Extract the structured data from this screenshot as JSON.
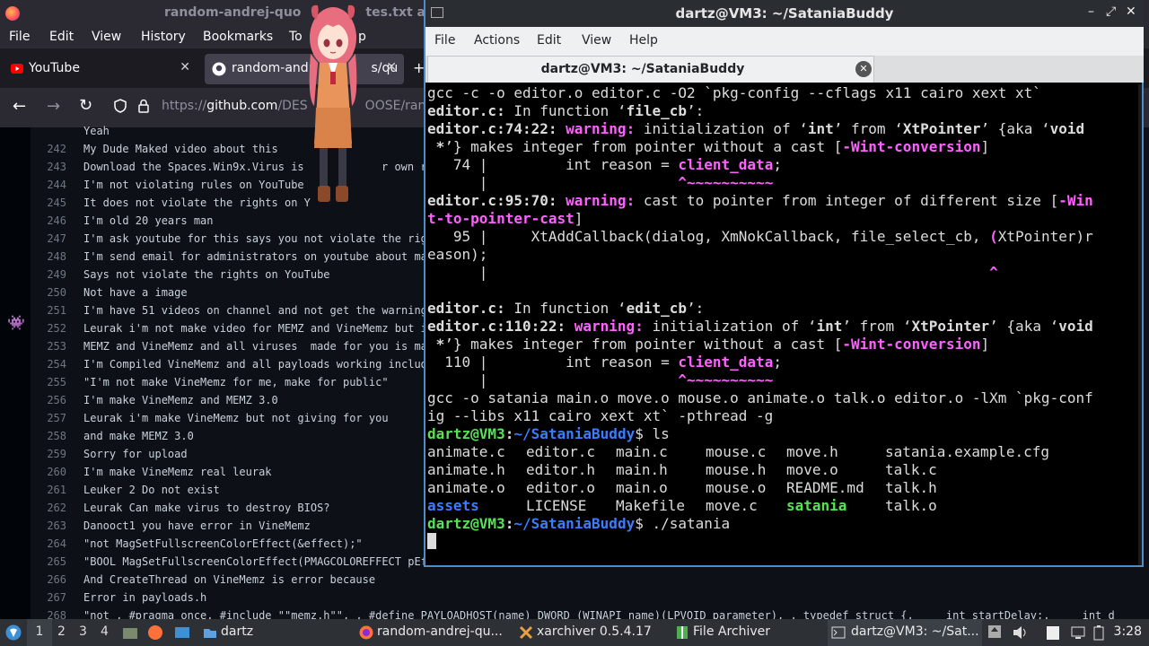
{
  "firefox": {
    "window_title": "random-andrej-quotes.txt at master · DESTROY_OOSE/random-andrej-quotes",
    "title_visible": "random-andrej-quo",
    "title_visible_end": "tes.txt a",
    "menu": [
      "File",
      "Edit",
      "View",
      "History",
      "Bookmarks",
      "Tools",
      "Help"
    ],
    "menu_tools_visible": "To",
    "menu_help_visible": "p",
    "tabs": [
      {
        "label": "YouTube",
        "icon": "youtube-icon"
      },
      {
        "label": "random-andr",
        "label_end": "s/qu",
        "icon": "github-icon"
      }
    ],
    "url_prefix": "https://",
    "url_host": "github.com",
    "url_path": "/DES",
    "url_path_end": "OOSE/rand",
    "code_lines": [
      {
        "n": "",
        "t": "Yeah"
      },
      {
        "n": "242",
        "t": "My Dude Maked video about this"
      },
      {
        "n": "243",
        "t": "Download the Spaces.Win9x.Virus is",
        "t2": "r own risk"
      },
      {
        "n": "244",
        "t": "I'm not violating rules on YouTube"
      },
      {
        "n": "245",
        "t": "It does not violate the rights on Y"
      },
      {
        "n": "246",
        "t": "I'm old 20 years man"
      },
      {
        "n": "247",
        "t": "I'm ask youtube for this says you not violate the rig"
      },
      {
        "n": "248",
        "t": "I'm send email for administrators on youtube about ma"
      },
      {
        "n": "249",
        "t": "Says not violate the rights on YouTube"
      },
      {
        "n": "250",
        "t": "Not have a image"
      },
      {
        "n": "251",
        "t": "I'm have 51 videos on channel and not get the warning"
      },
      {
        "n": "252",
        "t": "Leurak i'm not make video for MEMZ and VineMemz but i"
      },
      {
        "n": "253",
        "t": "MEMZ and VineMemz and all viruses  made for you is ma"
      },
      {
        "n": "254",
        "t": "I'm Compiled VineMemz and all payloads working includ"
      },
      {
        "n": "255",
        "t": "\"I'm not make VineMemz for me, make for public\""
      },
      {
        "n": "256",
        "t": "I'm make VineMemz and MEMZ 3.0"
      },
      {
        "n": "257",
        "t": "Leurak i'm make VineMemz but not giving for you"
      },
      {
        "n": "258",
        "t": "and make MEMZ 3.0"
      },
      {
        "n": "259",
        "t": "Sorry for upload"
      },
      {
        "n": "260",
        "t": "I'm make VineMemz real leurak"
      },
      {
        "n": "261",
        "t": "Leuker 2 Do not exist"
      },
      {
        "n": "262",
        "t": "Leurak Can make virus to destroy BIOS?"
      },
      {
        "n": "263",
        "t": "Danooct1 you have error in VineMemz"
      },
      {
        "n": "264",
        "t": "\"not MagSetFullscreenColorEffect(&effect);\""
      },
      {
        "n": "265",
        "t": "\"BOOL MagSetFullscreenColorEffect(PMAGCOLOREFFECT pEf"
      },
      {
        "n": "266",
        "t": "And CreateThread on VineMemz is error because"
      },
      {
        "n": "267",
        "t": "Error in payloads.h"
      },
      {
        "n": "268",
        "t": "\"not , #pragma once, #include \"\"memz.h\"\", , #define PAYLOADHOST(name) DWORD (WINAPI name)(LPVOID parameter), , typedef struct {,     int startDelay;,     int d"
      }
    ]
  },
  "terminal": {
    "title": "dartz@VM3: ~/SataniaBuddy",
    "menu": [
      "File",
      "Actions",
      "Edit",
      "View",
      "Help"
    ],
    "tab_label": "dartz@VM3: ~/SataniaBuddy",
    "prompt_user": "dartz@VM3",
    "prompt_path": "~/SataniaBuddy",
    "lines": {
      "l0": "gcc -c -o editor.o editor.c -O2 `pkg-config --cflags x11 cairo xext xt`",
      "l1a": "editor.c:",
      "l1b": " In function ‘",
      "l1c": "file_cb",
      "l1d": "’:",
      "l2a": "editor.c:74:22:",
      "l2w": " warning: ",
      "l2b": "initialization of ‘",
      "l2c": "int",
      "l2d": "’ from ‘",
      "l2e": "XtPointer",
      "l2f": "’ {aka ‘",
      "l2g": "void",
      "l3a": " *",
      "l3b": "’} makes integer from pointer without a cast [",
      "l3c": "-Wint-conversion",
      "l3d": "]",
      "l4a": "   74 |         int reason = ",
      "l4b": "client_data",
      "l4c": ";",
      "l5a": "      |                      ",
      "l5b": "^~~~~~~~~~~",
      "l6a": "editor.c:95:70:",
      "l6w": " warning: ",
      "l6b": "cast to pointer from integer of different size [",
      "l6c": "-Win",
      "l7a": "t-to-pointer-cast",
      "l7b": "]",
      "l8a": "   95 |     XtAddCallback(dialog, XmNokCallback, file_select_cb, ",
      "l8b": "(",
      "l8c": "XtPointer)r",
      "l9": "eason);",
      "l10a": "      |                                                          ",
      "l10b": "^",
      "l12a": "editor.c:",
      "l12b": " In function ‘",
      "l12c": "edit_cb",
      "l12d": "’:",
      "l13a": "editor.c:110:22:",
      "l13w": " warning: ",
      "l13b": "initialization of ‘",
      "l13c": "int",
      "l13d": "’ from ‘",
      "l13e": "XtPointer",
      "l13f": "’ {aka ‘",
      "l13g": "void",
      "l14a": " *",
      "l14b": "’} makes integer from pointer without a cast [",
      "l14c": "-Wint-conversion",
      "l14d": "]",
      "l15a": "  110 |         int reason = ",
      "l15b": "client_data",
      "l15c": ";",
      "l16a": "      |                      ",
      "l16b": "^~~~~~~~~~~",
      "l17": "gcc -o satania main.o move.o mouse.o animate.o talk.o editor.o -lXm `pkg-conf",
      "l18": "ig --libs x11 cairo xext xt` -pthread -g",
      "cmd1": "$ ls",
      "cmd2": "$ ./satania"
    },
    "ls_rows": [
      [
        "animate.c",
        "editor.c",
        "main.c",
        "mouse.c",
        "move.h",
        "satania.example.cfg"
      ],
      [
        "animate.h",
        "editor.h",
        "main.h",
        "mouse.h",
        "move.o",
        "talk.c"
      ],
      [
        "animate.o",
        "editor.o",
        "main.o",
        "mouse.o",
        "README.md",
        "talk.h"
      ],
      [
        "assets",
        "LICENSE",
        "Makefile",
        "move.c",
        "satania",
        "talk.o"
      ]
    ]
  },
  "taskbar": {
    "workspaces": [
      "1",
      "2",
      "3",
      "4"
    ],
    "items": [
      {
        "label": "dartz",
        "icon": "folder-icon"
      },
      {
        "label": "random-andrej-qu...",
        "icon": "firefox-icon"
      },
      {
        "label": "xarchiver 0.5.4.17",
        "icon": "xarchiver-icon"
      },
      {
        "label": "File Archiver",
        "icon": "archive-icon"
      },
      {
        "label": "dartz@VM3: ~/Sat...",
        "icon": "terminal-icon"
      }
    ],
    "clock": "3:28"
  },
  "colors": {
    "warning": "#ff60ff",
    "executable": "#57e357",
    "directory": "#3b7dff",
    "terminal_border": "#4d8dc9"
  }
}
